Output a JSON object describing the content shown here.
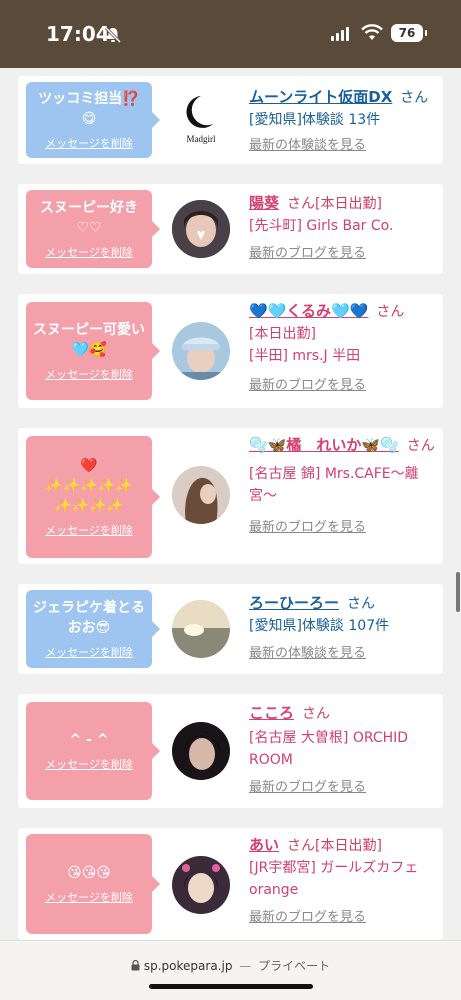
{
  "status": {
    "time": "17:04",
    "battery": "76"
  },
  "cards": [
    {
      "msg1": "ツッコミ担当⁉️",
      "msg2": "😋",
      "delete": "メッセージを削除",
      "bubble": "blue",
      "name": "ムーンライト仮面DX",
      "san": "さん",
      "tag": "",
      "detail": "[愛知県]体験談 13件",
      "latest": "最新の体験談を見る",
      "avatar_text": "Madgirl",
      "color": "blue"
    },
    {
      "msg1": "スヌーピー好き",
      "msg2": "♡♡",
      "delete": "メッセージを削除",
      "bubble": "pink",
      "name": "陽葵",
      "san": "さん",
      "tag": "[本日出勤]",
      "detail": "[先斗町] Girls Bar Co.",
      "latest": "最新のブログを見る",
      "color": "pink"
    },
    {
      "msg1": "スヌーピー可愛い",
      "msg2": "🩵🥰",
      "delete": "メッセージを削除",
      "bubble": "pink",
      "name": "💙🩵くるみ🩵💙",
      "san": "さん",
      "tag": "",
      "detail": "[本日出勤]",
      "detail2": "[半田] mrs.J 半田",
      "latest": "最新のブログを見る",
      "color": "pink"
    },
    {
      "msg1": "❤️",
      "msg2": "✨✨✨✨✨",
      "msg3": "✨✨✨✨",
      "delete": "メッセージを削除",
      "bubble": "pink",
      "name": "🫧🦋橘　れいか🦋🫧",
      "san": "さん",
      "tag": "",
      "detail": "[名古屋 錦] Mrs.CAFE〜離宮〜",
      "latest": "最新のブログを見る",
      "color": "pink"
    },
    {
      "msg1": "ジェラピケ着とる",
      "msg2": "おお😎",
      "delete": "メッセージを削除",
      "bubble": "blue",
      "name": "ろーひーろー",
      "san": "さん",
      "tag": "",
      "detail": "[愛知県]体験談 107件",
      "latest": "最新の体験談を見る",
      "color": "blue"
    },
    {
      "msg1": "^ - ^",
      "msg2": "",
      "delete": "メッセージを削除",
      "bubble": "pink",
      "name": "こころ",
      "san": "さん",
      "tag": "",
      "detail": "[名古屋 大曽根] ORCHID ROOM",
      "latest": "最新のブログを見る",
      "color": "pink"
    },
    {
      "msg1": "😘😘😘",
      "msg2": "",
      "delete": "メッセージを削除",
      "bubble": "pink",
      "name": "あい",
      "san": "さん",
      "tag": "[本日出勤]",
      "detail": "[JR宇都宮] ガールズカフェorange",
      "latest": "最新のブログを見る",
      "color": "pink"
    }
  ],
  "browser": {
    "url": "sp.pokepara.jp",
    "sep": "—",
    "mode": "プライベート"
  }
}
